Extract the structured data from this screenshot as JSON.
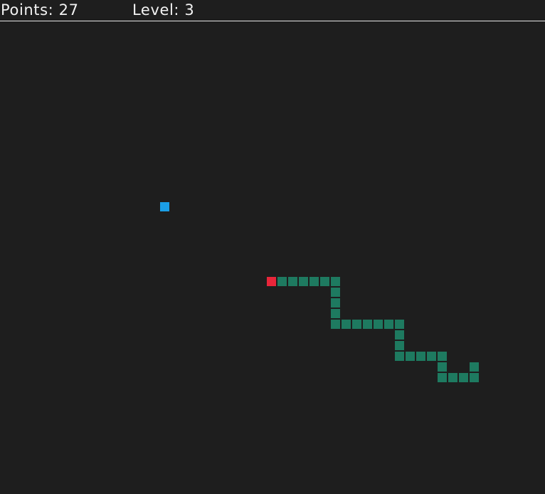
{
  "hud": {
    "points_label": "Points:",
    "points_value": "27",
    "level_label": "Level:",
    "level_value": "3"
  },
  "game": {
    "grid_cols": 51,
    "grid_rows": 44,
    "colors": {
      "background": "#1e1e1e",
      "snake_body": "#1e7a60",
      "snake_head": "#e8263a",
      "food": "#1b9ee6",
      "hud_text": "#f2f2f2",
      "hud_line": "#e6e6e6"
    },
    "food": {
      "col": 15,
      "row": 17
    },
    "snake": [
      {
        "col": 25,
        "row": 24
      },
      {
        "col": 26,
        "row": 24
      },
      {
        "col": 27,
        "row": 24
      },
      {
        "col": 28,
        "row": 24
      },
      {
        "col": 29,
        "row": 24
      },
      {
        "col": 30,
        "row": 24
      },
      {
        "col": 31,
        "row": 24
      },
      {
        "col": 31,
        "row": 25
      },
      {
        "col": 31,
        "row": 26
      },
      {
        "col": 31,
        "row": 27
      },
      {
        "col": 31,
        "row": 28
      },
      {
        "col": 32,
        "row": 28
      },
      {
        "col": 33,
        "row": 28
      },
      {
        "col": 34,
        "row": 28
      },
      {
        "col": 35,
        "row": 28
      },
      {
        "col": 36,
        "row": 28
      },
      {
        "col": 37,
        "row": 28
      },
      {
        "col": 37,
        "row": 29
      },
      {
        "col": 37,
        "row": 30
      },
      {
        "col": 37,
        "row": 31
      },
      {
        "col": 38,
        "row": 31
      },
      {
        "col": 39,
        "row": 31
      },
      {
        "col": 40,
        "row": 31
      },
      {
        "col": 41,
        "row": 31
      },
      {
        "col": 41,
        "row": 32
      },
      {
        "col": 41,
        "row": 33
      },
      {
        "col": 42,
        "row": 33
      },
      {
        "col": 43,
        "row": 33
      },
      {
        "col": 44,
        "row": 33
      },
      {
        "col": 44,
        "row": 32
      }
    ]
  }
}
